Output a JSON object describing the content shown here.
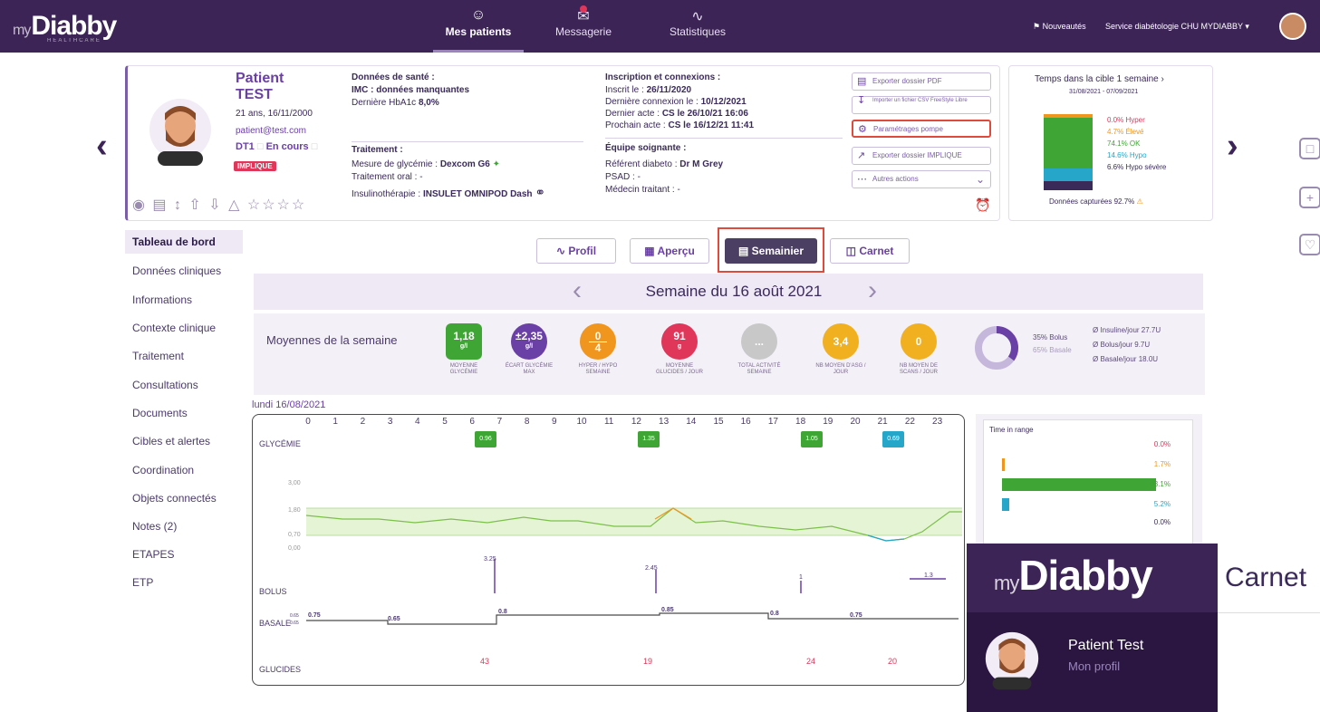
{
  "nav": {
    "logo_my": "my",
    "logo_main": "Diabby",
    "logo_sub": "HEALTHCARE",
    "items": [
      {
        "label": "Mes patients",
        "icon": "patients-icon"
      },
      {
        "label": "Messagerie",
        "icon": "message-icon"
      },
      {
        "label": "Statistiques",
        "icon": "chart-icon"
      }
    ],
    "news": "Nouveautés",
    "service": "Service diabétologie CHU MYDIABBY"
  },
  "patient": {
    "first": "Patient",
    "last": "TEST",
    "age": "21 ans, 16/11/2000",
    "email": "patient@test.com",
    "dti": "DT1",
    "status": "En cours",
    "badge": "IMPLIQUE"
  },
  "sante": {
    "title": "Données de santé :",
    "imc": "IMC : données manquantes",
    "hba1c": "Dernière HbA1c",
    "hba1c_val": "8,0%"
  },
  "traitement": {
    "title": "Traitement :",
    "mesure": "Mesure de glycémie :",
    "mesure_val": "Dexcom G6",
    "oral": "Traitement oral : -",
    "insulino": "Insulinothérapie :",
    "insulino_val": "INSULET OMNIPOD Dash"
  },
  "inscription": {
    "title": "Inscription et connexions :",
    "inscrit": "Inscrit le :",
    "inscrit_val": "26/11/2020",
    "derniere": "Dernière connexion le :",
    "derniere_val": "10/12/2021",
    "dernier_acte": "Dernier acte :",
    "dernier_acte_val": "CS le 26/10/21 16:06",
    "prochain": "Prochain acte :",
    "prochain_val": "CS le 16/12/21 11:41"
  },
  "equipe": {
    "title": "Équipe soignante :",
    "referent": "Référent diabeto :",
    "referent_val": "Dr M Grey",
    "psad": "PSAD : -",
    "medecin": "Médecin traitant : -"
  },
  "actions": {
    "pdf": "Exporter dossier PDF",
    "csv": "Importer un fichier CSV FreeStyle Libre",
    "pompe": "Paramétrages pompe",
    "impl": "Exporter dossier IMPLIQUE",
    "autres": "Autres actions"
  },
  "tir_card": {
    "title": "Temps dans la cible 1 semaine",
    "dates": "31/08/2021 - 07/09/2021",
    "hyper": "0.0% Hyper",
    "eleve": "4.7% Élevé",
    "ok": "74.1% OK",
    "hypo": "14.6% Hypo",
    "hypo_sev": "6.6% Hypo sévère",
    "captured": "Données capturées 92.7%"
  },
  "sidebar": [
    "Tableau de bord",
    "Données cliniques",
    "Informations",
    "Contexte clinique",
    "Traitement",
    "Consultations",
    "Documents",
    "Cibles et alertes",
    "Coordination",
    "Objets connectés",
    "Notes (2)",
    "ETAPES",
    "ETP"
  ],
  "tabs": [
    "Profil",
    "Aperçu",
    "Semainier",
    "Carnet"
  ],
  "week": {
    "title": "Semaine du 16 août 2021",
    "avg_label": "Moyennes de la semaine"
  },
  "stats": [
    {
      "v1": "1,18",
      "v2": "g/l",
      "cap": "MOYENNE GLYCÉMIE",
      "color": "#3fa535"
    },
    {
      "v1": "±2,35",
      "v2": "g/l",
      "cap": "ÉCART GLYCÉMIE MAX",
      "color": "#6a3fa6"
    },
    {
      "v1": "0",
      "v2": "4",
      "cap": "HYPER / HYPO SEMAINE",
      "color": "#f0961e"
    },
    {
      "v1": "91",
      "v2": "g",
      "cap": "MOYENNE GLUCIDES / JOUR",
      "color": "#e0365a"
    },
    {
      "v1": "...",
      "v2": "",
      "cap": "TOTAL ACTIVITÉ SEMAINE",
      "color": "#c8c8c8"
    },
    {
      "v1": "3,4",
      "v2": "",
      "cap": "NB MOYEN D'ASG / JOUR",
      "color": "#f0b020"
    },
    {
      "v1": "0",
      "v2": "",
      "cap": "NB MOYEN DE SCANS / JOUR",
      "color": "#f0b020"
    }
  ],
  "insulin": {
    "bolus_pct": "35% Bolus",
    "basale_pct": "65% Basale",
    "per_day": "Ø Insuline/jour 27.7U",
    "bolus_day": "Ø Bolus/jour 9.7U",
    "basale_day": "Ø Basale/jour 18.0U"
  },
  "graph": {
    "date": "lundi 16/08/2021",
    "hours": [
      "0",
      "1",
      "2",
      "3",
      "4",
      "5",
      "6",
      "7",
      "8",
      "9",
      "10",
      "11",
      "12",
      "13",
      "14",
      "15",
      "16",
      "17",
      "18",
      "19",
      "20",
      "21",
      "22",
      "23"
    ],
    "rows": [
      "GLYCÉMIE",
      "BOLUS",
      "BASALE",
      "GLUCIDES"
    ],
    "y_ticks": [
      "3,00",
      "1,80",
      "0,70",
      "0,00"
    ],
    "basale_ticks": [
      "0.65",
      "0.65"
    ],
    "badges": [
      {
        "val": "0.96",
        "color": "#3fa535"
      },
      {
        "val": "1.35",
        "color": "#3fa535"
      },
      {
        "val": "1.05",
        "color": "#3fa535"
      },
      {
        "val": "0.69",
        "color": "#26a6c8"
      }
    ],
    "bolus": [
      "3.25",
      "2.45",
      "1",
      "1.3"
    ],
    "basale": [
      "0.75",
      "0.65",
      "0.8",
      "0.85",
      "0.8",
      "0.75"
    ],
    "glucides": [
      "43",
      "19",
      "24",
      "20"
    ]
  },
  "time_in_range": {
    "title": "Time in range",
    "values": [
      "0.0%",
      "1.7%",
      "93.1%",
      "5.2%",
      "0.0%"
    ]
  },
  "overlay": {
    "logo_my": "my",
    "logo_main": "Diabby",
    "carnet": "Carnet",
    "name": "Patient Test",
    "profile": "Mon profil"
  }
}
